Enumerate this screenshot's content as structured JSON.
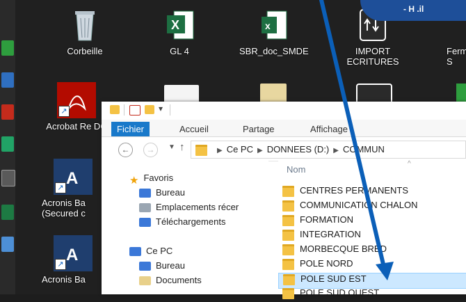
{
  "desktop": {
    "icons": [
      {
        "label": "Corbeille",
        "icon": "recycle-bin-icon"
      },
      {
        "label": "GL 4",
        "icon": "excel-icon"
      },
      {
        "label": "SBR_doc_SMDE",
        "icon": "excel-icon"
      },
      {
        "label": "IMPORT ECRITURES",
        "icon": "import-icon"
      },
      {
        "label": "Ferm S",
        "icon": "app-icon"
      },
      {
        "label": "Acrobat Re DC",
        "icon": "acrobat-icon"
      },
      {
        "label": "Acronis Ba (Secured c",
        "icon": "acronis-icon"
      },
      {
        "label": "Acronis Ba",
        "icon": "acronis-icon"
      }
    ],
    "network_badge": "- H .il"
  },
  "explorer": {
    "ribbon_tabs": [
      "Fichier",
      "Accueil",
      "Partage",
      "Affichage"
    ],
    "address": [
      "Ce PC",
      "DONNEES (D:)",
      "COMMUN"
    ],
    "nav": {
      "favorites_label": "Favoris",
      "favorites": [
        "Bureau",
        "Emplacements récer",
        "Téléchargements"
      ],
      "pc_label": "Ce PC",
      "pc_items": [
        "Bureau",
        "Documents"
      ]
    },
    "column_header": "Nom",
    "files": [
      "CENTRES PERMANENTS",
      "COMMUNICATION CHALON",
      "FORMATION",
      "INTEGRATION",
      "MORBECQUE BRED",
      "POLE NORD",
      "POLE SUD EST",
      "POLE SUD OUEST"
    ],
    "selected_file": "POLE SUD EST"
  },
  "colors": {
    "accent": "#1979ca",
    "arrow": "#0b5fb8",
    "selection": "#cce8ff"
  }
}
